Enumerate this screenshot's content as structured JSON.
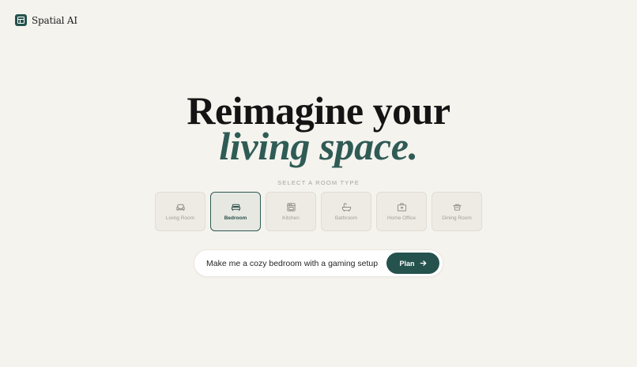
{
  "brand": {
    "name": "Spatial AI",
    "icon": "layout-square-icon"
  },
  "hero": {
    "line1": "Reimagine your",
    "line2": "living space."
  },
  "room_selector": {
    "label": "SELECT A ROOM TYPE",
    "selected": "Bedroom",
    "items": [
      {
        "label": "Living Room",
        "icon": "sofa-icon"
      },
      {
        "label": "Bedroom",
        "icon": "bed-icon"
      },
      {
        "label": "Kitchen",
        "icon": "oven-icon"
      },
      {
        "label": "Bathroom",
        "icon": "bathtub-icon"
      },
      {
        "label": "Home Office",
        "icon": "briefcase-icon"
      },
      {
        "label": "Dining Room",
        "icon": "dining-table-icon"
      }
    ]
  },
  "prompt": {
    "value": "Make me a cozy bedroom with a gaming setup",
    "button_label": "Plan",
    "button_icon": "arrow-right-icon"
  },
  "colors": {
    "accent": "#25524d",
    "background": "#f5f3ee",
    "headline_italic": "#2f5b55"
  }
}
